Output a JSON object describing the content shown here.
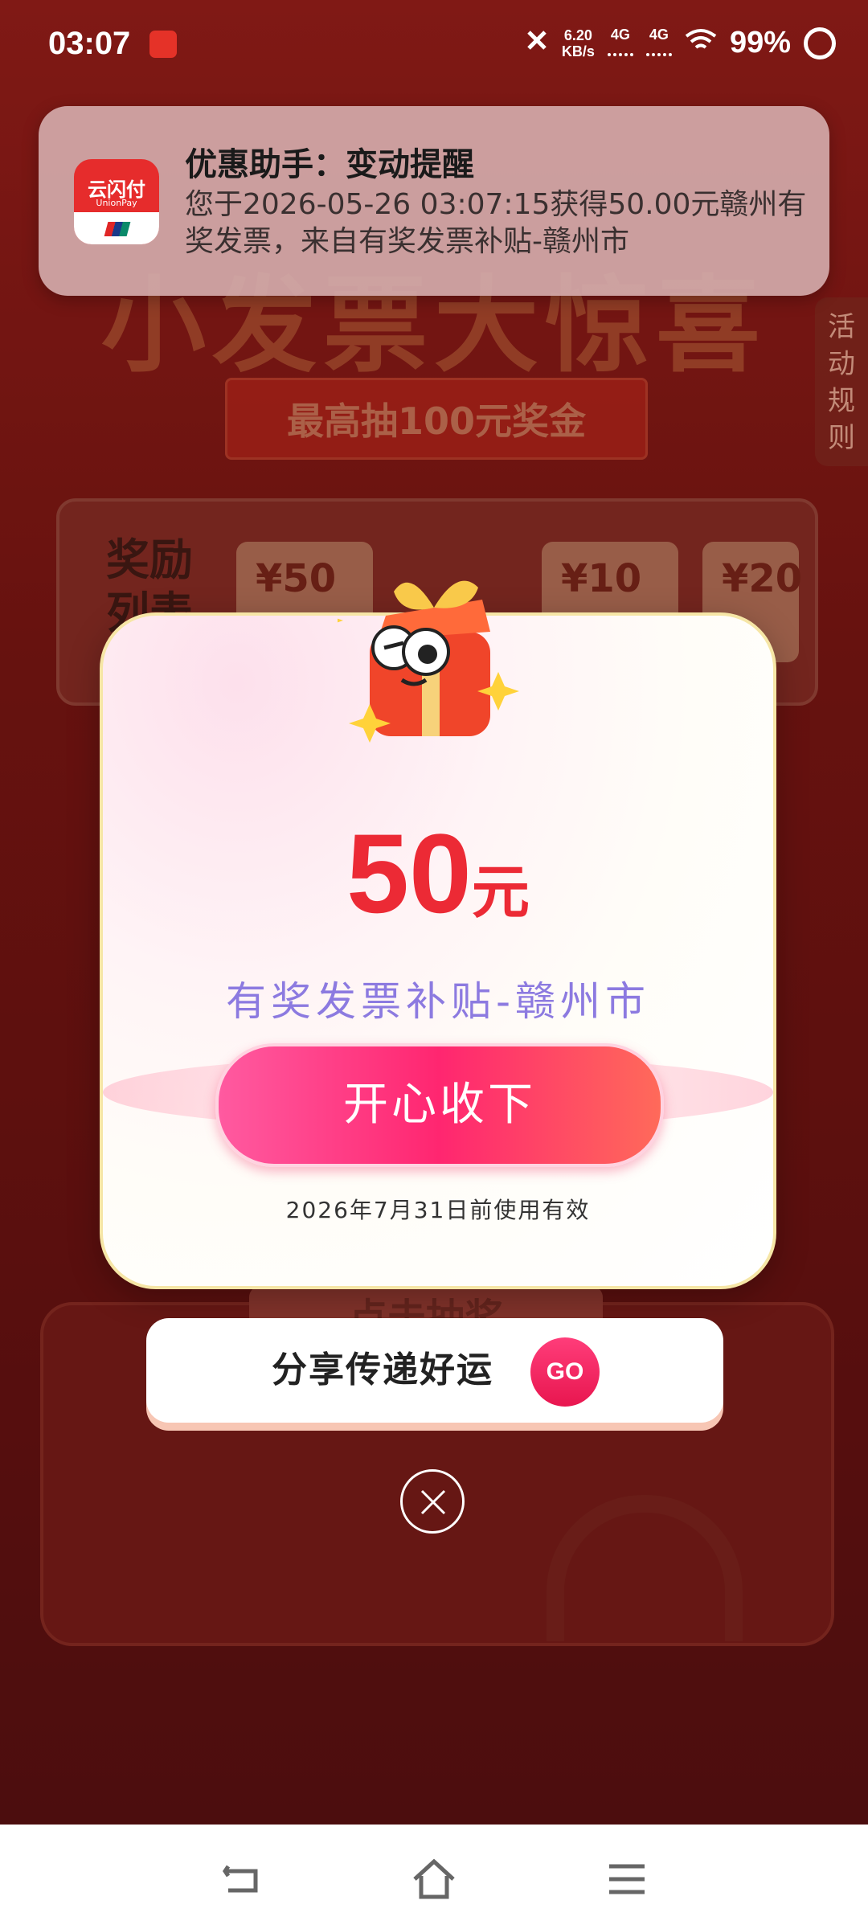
{
  "status_bar": {
    "time": "03:07",
    "net_speed_value": "6.20",
    "net_speed_unit": "KB/s",
    "sim1": "4G",
    "sim2": "4G",
    "battery": "99%"
  },
  "notification": {
    "title": "优惠助手：变动提醒",
    "body": "您于2026-05-26 03:07:15获得50.00元赣州有奖发票，来自有奖发票补贴-赣州市",
    "app_icon_brand": "云闪付",
    "app_icon_sub": "UnionPay"
  },
  "background": {
    "banner_title": "小发票大惊喜",
    "banner_subtitle": "最高抽100元奖金",
    "rules_tab": "活动规则",
    "reward_list_label": "奖励列表",
    "reward_chips": [
      "¥50",
      "¥10",
      "¥20"
    ],
    "draw_button": "点击抽奖"
  },
  "modal": {
    "amount": "50",
    "unit": "元",
    "subsidy_name": "有奖发票补贴-赣州市",
    "accept_label": "开心收下",
    "validity": "2026年7月31日前使用有效"
  },
  "share": {
    "label": "分享传递好运",
    "go": "GO"
  },
  "colors": {
    "accent_red": "#ec2a35",
    "subsidy_purple": "#8c7ae0",
    "button_pink": "#ff2670"
  }
}
